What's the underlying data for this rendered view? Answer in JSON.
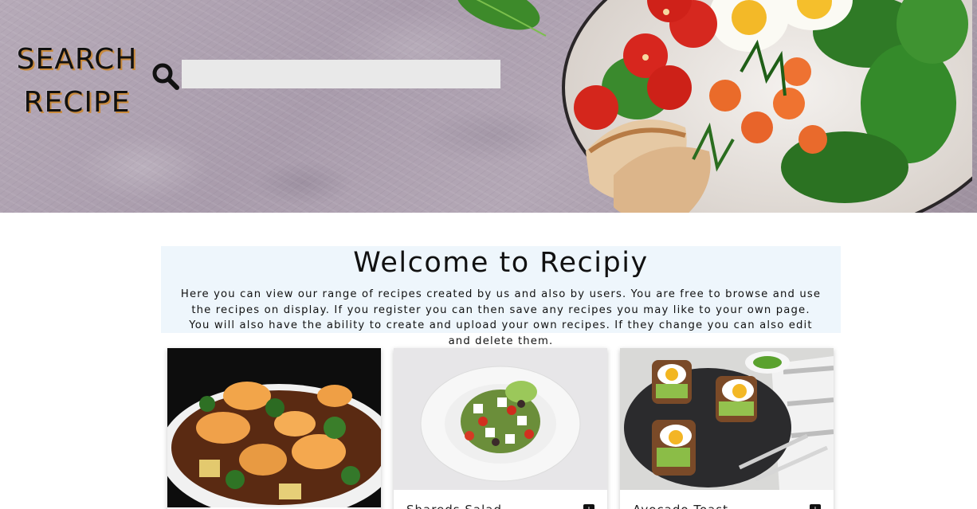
{
  "hero": {
    "title_line1": "SEARCH",
    "title_line2": "RECIPE",
    "search": {
      "value": "",
      "placeholder": ""
    }
  },
  "welcome": {
    "heading": "Welcome to Recipiy",
    "paragraph1": "Here you can view our range of recipes created by us and also by users. You are free to browse and use the recipes on display. If you register you can then save any recipes you may like to your own page.",
    "paragraph2": "You will also have the ability to create and upload your own recipes. If they change you can also edit and delete them."
  },
  "cards": [
    {
      "title": "",
      "image": "shrimp-dish"
    },
    {
      "title": "Shareds Salad",
      "image": "greek-salad"
    },
    {
      "title": "Avocado Toast",
      "image": "egg-avocado-toast"
    }
  ],
  "colors": {
    "hero_stone": "#ada0af",
    "title_shadow": "#c98a3c",
    "welcome_bg": "#eef6fc",
    "search_bg": "#e9e9e9"
  },
  "icons": [
    "search-icon",
    "bookmark-icon"
  ]
}
